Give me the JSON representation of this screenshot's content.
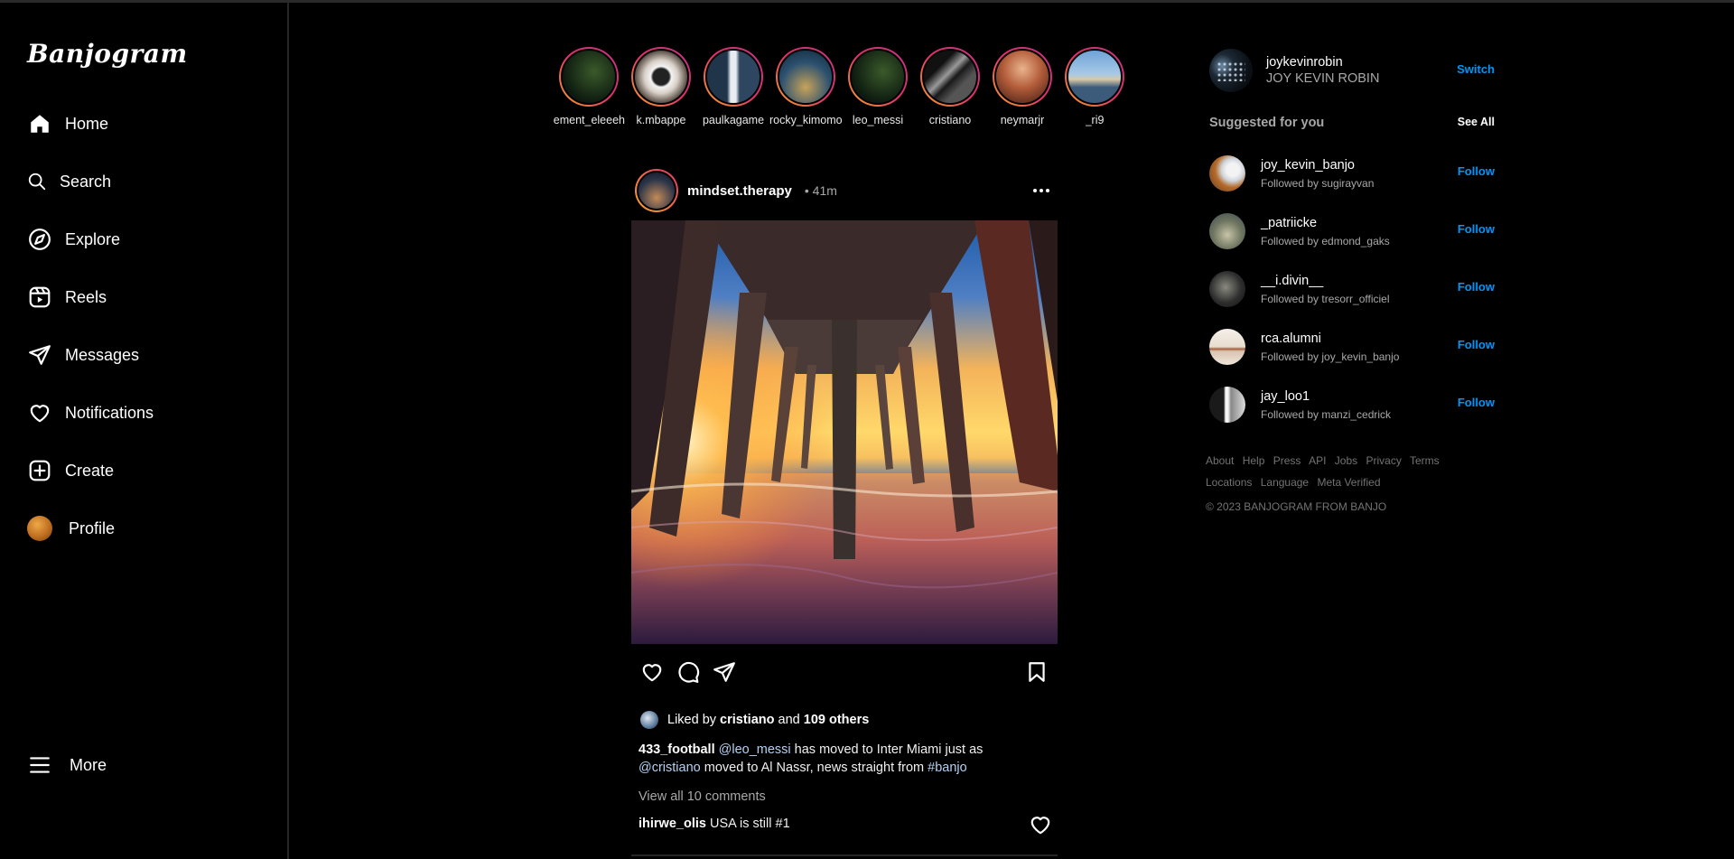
{
  "app": {
    "logo": "Banjogram"
  },
  "sidebar": {
    "items": [
      {
        "label": "Home"
      },
      {
        "label": "Search"
      },
      {
        "label": "Explore"
      },
      {
        "label": "Reels"
      },
      {
        "label": "Messages"
      },
      {
        "label": "Notifications"
      },
      {
        "label": "Create"
      },
      {
        "label": "Profile"
      }
    ],
    "more_label": "More"
  },
  "stories": [
    {
      "name": "element_eleeeh"
    },
    {
      "name": "k.mbappe"
    },
    {
      "name": "paulkagame"
    },
    {
      "name": "rocky_kimomo"
    },
    {
      "name": "leo_messi"
    },
    {
      "name": "cristiano"
    },
    {
      "name": "neymarjr"
    },
    {
      "name": "_ri9"
    }
  ],
  "post": {
    "username": "mindset.therapy",
    "time": "• 41m",
    "liked_prefix": "Liked by",
    "liked_user": "cristiano",
    "liked_and": "and",
    "liked_others": "109 others",
    "caption": {
      "user": "433_football",
      "mention1": "@leo_messi",
      "text1": "has moved to Inter Miami just as",
      "mention2": "@cristiano",
      "text2": "moved to Al Nassr, news straight from",
      "hashtag": "#banjo"
    },
    "view_all": "View all 10 comments",
    "comment": {
      "user": "ihirwe_olis",
      "text": "USA is still #1"
    }
  },
  "right": {
    "me": {
      "username": "joykevinrobin",
      "fullname": "JOY KEVIN ROBIN",
      "switch_label": "Switch"
    },
    "suggested_title": "Suggested for you",
    "see_all": "See All",
    "follow_label": "Follow",
    "suggestions": [
      {
        "user": "joy_kevin_banjo",
        "sub": "Followed by sugirayvan"
      },
      {
        "user": "_patriicke",
        "sub": "Followed by edmond_gaks"
      },
      {
        "user": "__i.divin__",
        "sub": "Followed by tresorr_officiel"
      },
      {
        "user": "rca.alumni",
        "sub": "Followed by joy_kevin_banjo"
      },
      {
        "user": "jay_loo1",
        "sub": "Followed by manzi_cedrick"
      }
    ],
    "footer_links": [
      "About",
      "Help",
      "Press",
      "API",
      "Jobs",
      "Privacy",
      "Terms",
      "Locations",
      "Language",
      "Meta Verified"
    ],
    "copyright": "© 2023 BANJOGRAM FROM BANJO"
  }
}
